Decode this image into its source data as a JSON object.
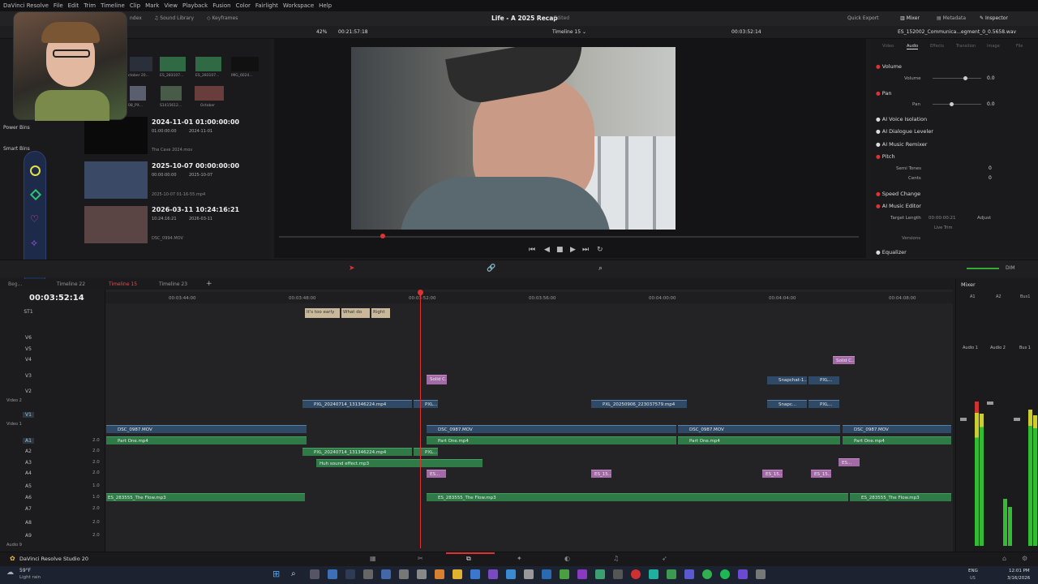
{
  "menu": [
    "DaVinci Resolve",
    "File",
    "Edit",
    "Trim",
    "Timeline",
    "Clip",
    "Mark",
    "View",
    "Playback",
    "Fusion",
    "Color",
    "Fairlight",
    "Workspace",
    "Help"
  ],
  "topbar": {
    "project_title": "Life - A 2025 Recap",
    "edited": "Edited",
    "quick_export": "Quick Export",
    "mixer": "Mixer",
    "metadata": "Metadata",
    "inspector": "Inspector",
    "index": "ndex",
    "sound_library": "Sound Library",
    "keyframes": "Keyframes"
  },
  "viewer": {
    "zoom": "42%",
    "timecode_left": "00:21:57:18",
    "timeline_name": "Timeline 15",
    "timecode_right": "00:03:52:14"
  },
  "inspector": {
    "filename": "ES_152002_Communica...egment_0_0.5658.wav",
    "tabs": [
      "Video",
      "Audio",
      "Effects",
      "Transition",
      "Image",
      "File"
    ],
    "active_tab": "Audio",
    "volume": "Volume",
    "volume_label": "Volume",
    "volume_val": "0.0",
    "pan": "Pan",
    "pan_label": "Pan",
    "pan_val": "0.0",
    "ai_voice": "AI Voice Isolation",
    "ai_dialogue": "AI Dialogue Leveler",
    "ai_music": "AI Music Remixer",
    "pitch": "Pitch",
    "semi": "Semi Tones",
    "semi_val": "0",
    "cents": "Cents",
    "cents_val": "0",
    "speed": "Speed Change",
    "ai_editor": "AI Music Editor",
    "target_len": "Target Length",
    "target_val": "00:00:00:21",
    "adjust": "Adjust",
    "live_trim": "Live Trim",
    "versions": "Versions",
    "eq": "Equalizer"
  },
  "media": {
    "thumbs_row1": [
      "ctober 20...",
      "ES_283107...",
      "ES_283107...",
      "IMG_6024..."
    ],
    "thumbs_row2": [
      "08_PX...",
      "S1415612...",
      "October"
    ],
    "items": [
      {
        "date": "2024-11-01 01:00:00:00",
        "tc": "01:00:00:00",
        "date2": "2024-11-01",
        "name": "The Cave 2024.mov"
      },
      {
        "date": "2025-10-07 00:00:00:00",
        "tc": "00:00:00:00",
        "date2": "2025-10-07",
        "name": "2025-10-07 01-16-55.mp4"
      },
      {
        "date": "2026-03-11 10:24:16:21",
        "tc": "10:24:16:21",
        "date2": "2026-03-11",
        "name": "DSC_0994.MOV"
      }
    ],
    "power_bins": "Power Bins",
    "smart_bins": "Smart Bins"
  },
  "timeline": {
    "tabs": [
      "Beg...",
      "Timeline 22",
      "Timeline 15",
      "Timeline 23"
    ],
    "timecode": "00:03:52:14",
    "ruler": [
      "00:03:44:00",
      "00:03:48:00",
      "00:03:52:00",
      "00:03:56:00",
      "00:04:00:00",
      "00:04:04:00",
      "00:04:08:00"
    ],
    "tracks": [
      "ST1",
      "V6",
      "V5",
      "V4",
      "V3",
      "V2",
      "V1",
      "A1",
      "A2",
      "A3",
      "A4",
      "A5",
      "A6",
      "A7",
      "A8",
      "A9"
    ],
    "vals": [
      "2.0",
      "2.0",
      "2.0",
      "2.0",
      "1.0",
      "1.0",
      "2.0",
      "2.0",
      "2.0"
    ],
    "video2": "Video 2",
    "video1": "Video 1",
    "audio9": "Audio 9",
    "subs": [
      "It's too early",
      "What do",
      "Right"
    ],
    "clips": {
      "dsc": "DSC_0987.MOV",
      "pxl1": "PXL_20240714_131346224.mp4",
      "pxl_s": "PXL...",
      "pxl2": "PXL_20250906_223037579.mp4",
      "snap": "Snapchat-1...",
      "snapc": "Snapc...",
      "solid": "Solid C...",
      "part": "Part One.mp4",
      "huh": "Huh sound effect.mp3",
      "es": "ES_15...",
      "es_short": "ES...",
      "flow": "ES_283555_The Flow.mp3"
    }
  },
  "mixer": {
    "title": "Mixer",
    "dim": "DIM",
    "cols": [
      "A1",
      "A2",
      "Bus1"
    ],
    "audio1": "Audio 1",
    "audio2": "Audio 2",
    "bus1": "Bus 1"
  },
  "taskbar": {
    "app": "DaVinci Resolve Studio 20",
    "temp": "59°F",
    "weather": "Light rain",
    "lang": "ENG",
    "region": "US",
    "time": "12:01 PM",
    "date": "3/16/2026"
  }
}
